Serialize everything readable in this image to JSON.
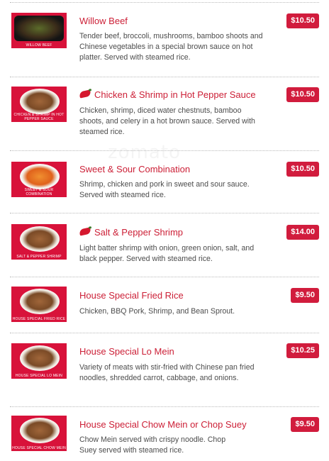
{
  "watermark": "zomato",
  "colors": {
    "title_red": "#cc1f36",
    "price_bg": "#d11c3d",
    "thumb_bg": "#d8123a",
    "text": "#4c4c4c"
  },
  "items": [
    {
      "name": "Willow Beef",
      "spicy": false,
      "price": "$10.50",
      "description": "Tender beef, broccoli, mushrooms, bamboo shoots and Chinese vegetables in a special brown sauce on hot platter. Served with steamed rice.",
      "photo_caption": "WILLOW BEEF"
    },
    {
      "name": "Chicken & Shrimp in Hot Pepper Sauce",
      "spicy": true,
      "price": "$10.50",
      "description": "Chicken, shrimp, diced water chestnuts, bamboo shoots, and celery in a hot brown sauce. Served with steamed rice.",
      "photo_caption": "CHICKEN & SHRIMP IN HOT PEPPER SAUCE"
    },
    {
      "name": "Sweet & Sour Combination",
      "spicy": false,
      "price": "$10.50",
      "description": "Shrimp, chicken and pork in sweet and sour sauce. Served with steamed rice.",
      "photo_caption": "SWEET & SOUR COMBINATION"
    },
    {
      "name": "Salt & Pepper Shrimp",
      "spicy": true,
      "price": "$14.00",
      "description": "Light batter shrimp with onion, green onion, salt, and black pepper. Served with steamed rice.",
      "photo_caption": "SALT & PEPPER SHRIMP"
    },
    {
      "name": "House Special Fried Rice",
      "spicy": false,
      "price": "$9.50",
      "description": "Chicken, BBQ Pork, Shrimp, and Bean Sprout.",
      "photo_caption": "HOUSE SPECIAL FRIED RICE"
    },
    {
      "name": "House Special Lo Mein",
      "spicy": false,
      "price": "$10.25",
      "description": "Variety of meats with stir-fried with Chinese pan fried noodles, shredded carrot, cabbage, and onions.",
      "photo_caption": "HOUSE SPECIAL LO MEIN"
    },
    {
      "name": "House Special Chow Mein or Chop Suey",
      "spicy": false,
      "price": "$9.50",
      "description": "Chow Mein served with crispy noodle. Chop Suey served with steamed rice.",
      "photo_caption": "HOUSE SPECIAL CHOW MEIN"
    }
  ]
}
